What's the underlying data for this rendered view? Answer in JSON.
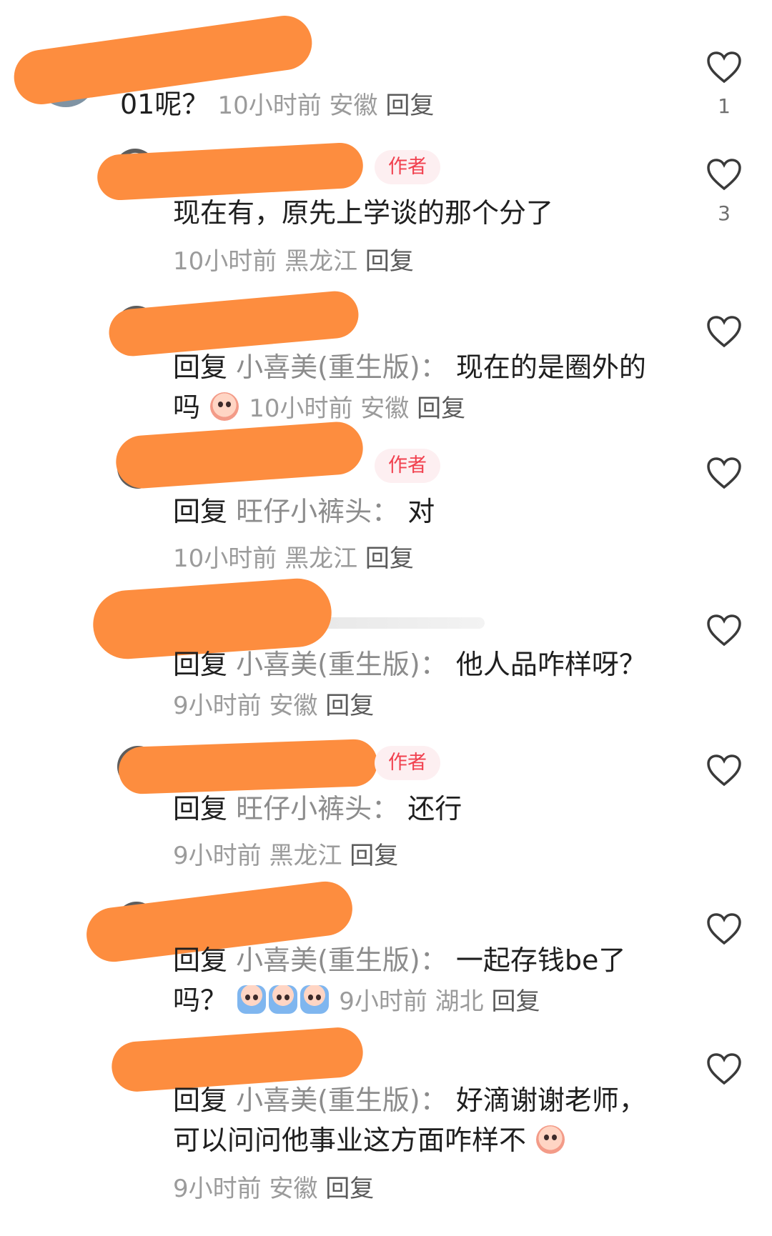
{
  "colors": {
    "redaction": "#fd8d3f",
    "author_badge_bg": "#fdeff1",
    "author_badge_text": "#f1414f",
    "meta_text": "#9b9b9b",
    "reply_target": "#8c8c8c"
  },
  "comments": [
    {
      "text": "01呢？",
      "meta_time": "10小时前",
      "meta_location": "安徽",
      "reply_label": "回复",
      "like_count": "1"
    },
    {
      "author_badge": "作者",
      "text": "现在有，原先上学谈的那个分了",
      "meta_time": "10小时前",
      "meta_location": "黑龙江",
      "reply_label": "回复",
      "like_count": "3"
    },
    {
      "reply_word": "回复",
      "reply_target": "小喜美(重生版)：",
      "text": "现在的是圈外的吗",
      "emoji": "crying-peach-emoji",
      "meta_time": "10小时前",
      "meta_location": "安徽",
      "reply_label": "回复"
    },
    {
      "author_badge": "作者",
      "reply_word": "回复",
      "reply_target": "旺仔小裤头：",
      "text": "对",
      "meta_time": "10小时前",
      "meta_location": "黑龙江",
      "reply_label": "回复"
    },
    {
      "reply_word": "回复",
      "reply_target": "小喜美(重生版)：",
      "text": "他人品咋样呀？",
      "meta_time": "9小时前",
      "meta_location": "安徽",
      "reply_label": "回复"
    },
    {
      "author_badge": "作者",
      "reply_word": "回复",
      "reply_target": "旺仔小裤头：",
      "text": "还行",
      "meta_time": "9小时前",
      "meta_location": "黑龙江",
      "reply_label": "回复"
    },
    {
      "reply_word": "回复",
      "reply_target": "小喜美(重生版)：",
      "text": "一起存钱be了吗？",
      "emoji": "splashing-peach-emoji",
      "meta_time": "9小时前",
      "meta_location": "湖北",
      "reply_label": "回复"
    },
    {
      "reply_word": "回复",
      "reply_target": "小喜美(重生版)：",
      "text": "好滴谢谢老师，可以问问他事业这方面咋样不",
      "emoji": "crying-peach-emoji",
      "meta_time": "9小时前",
      "meta_location": "安徽",
      "reply_label": "回复"
    }
  ]
}
